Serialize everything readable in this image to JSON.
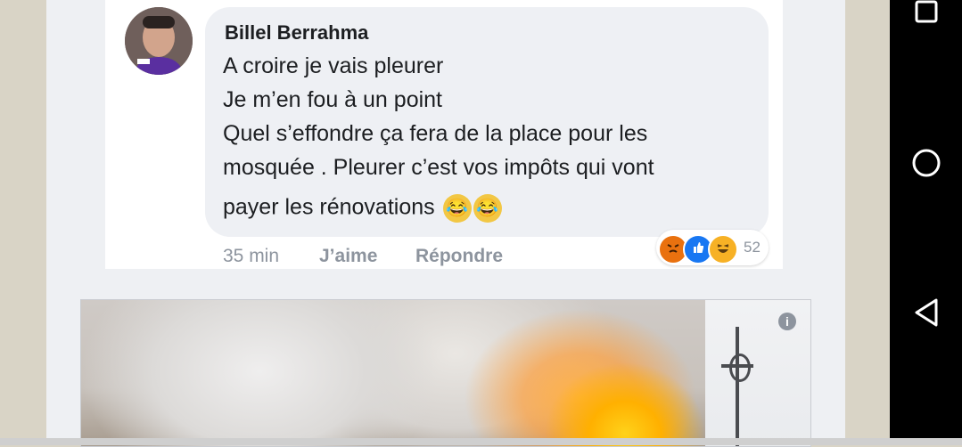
{
  "comment": {
    "author": "Billel Berrahma",
    "lines": [
      "A croire je vais pleurer",
      "Je m’en fou à un point",
      "Quel s’effondre ça fera de la place pour les",
      "mosquée . Pleurer c’est vos impôts qui vont",
      "payer les rénovations"
    ],
    "emoji": [
      "😂",
      "😂"
    ],
    "time": "35 min",
    "like_label": "J’aime",
    "reply_label": "Répondre",
    "reaction_count": "52",
    "reaction_icons": [
      "angry-icon",
      "like-icon",
      "haha-icon"
    ]
  },
  "link_card": {
    "image": "cathedral-fire-photo",
    "info_icon": "info-icon"
  },
  "system_nav": {
    "buttons": [
      "recent-apps-icon",
      "home-icon",
      "back-icon"
    ]
  },
  "colors": {
    "reaction_angry": "#e9710f",
    "reaction_like": "#1877f2",
    "reaction_haha": "#f7b125"
  }
}
